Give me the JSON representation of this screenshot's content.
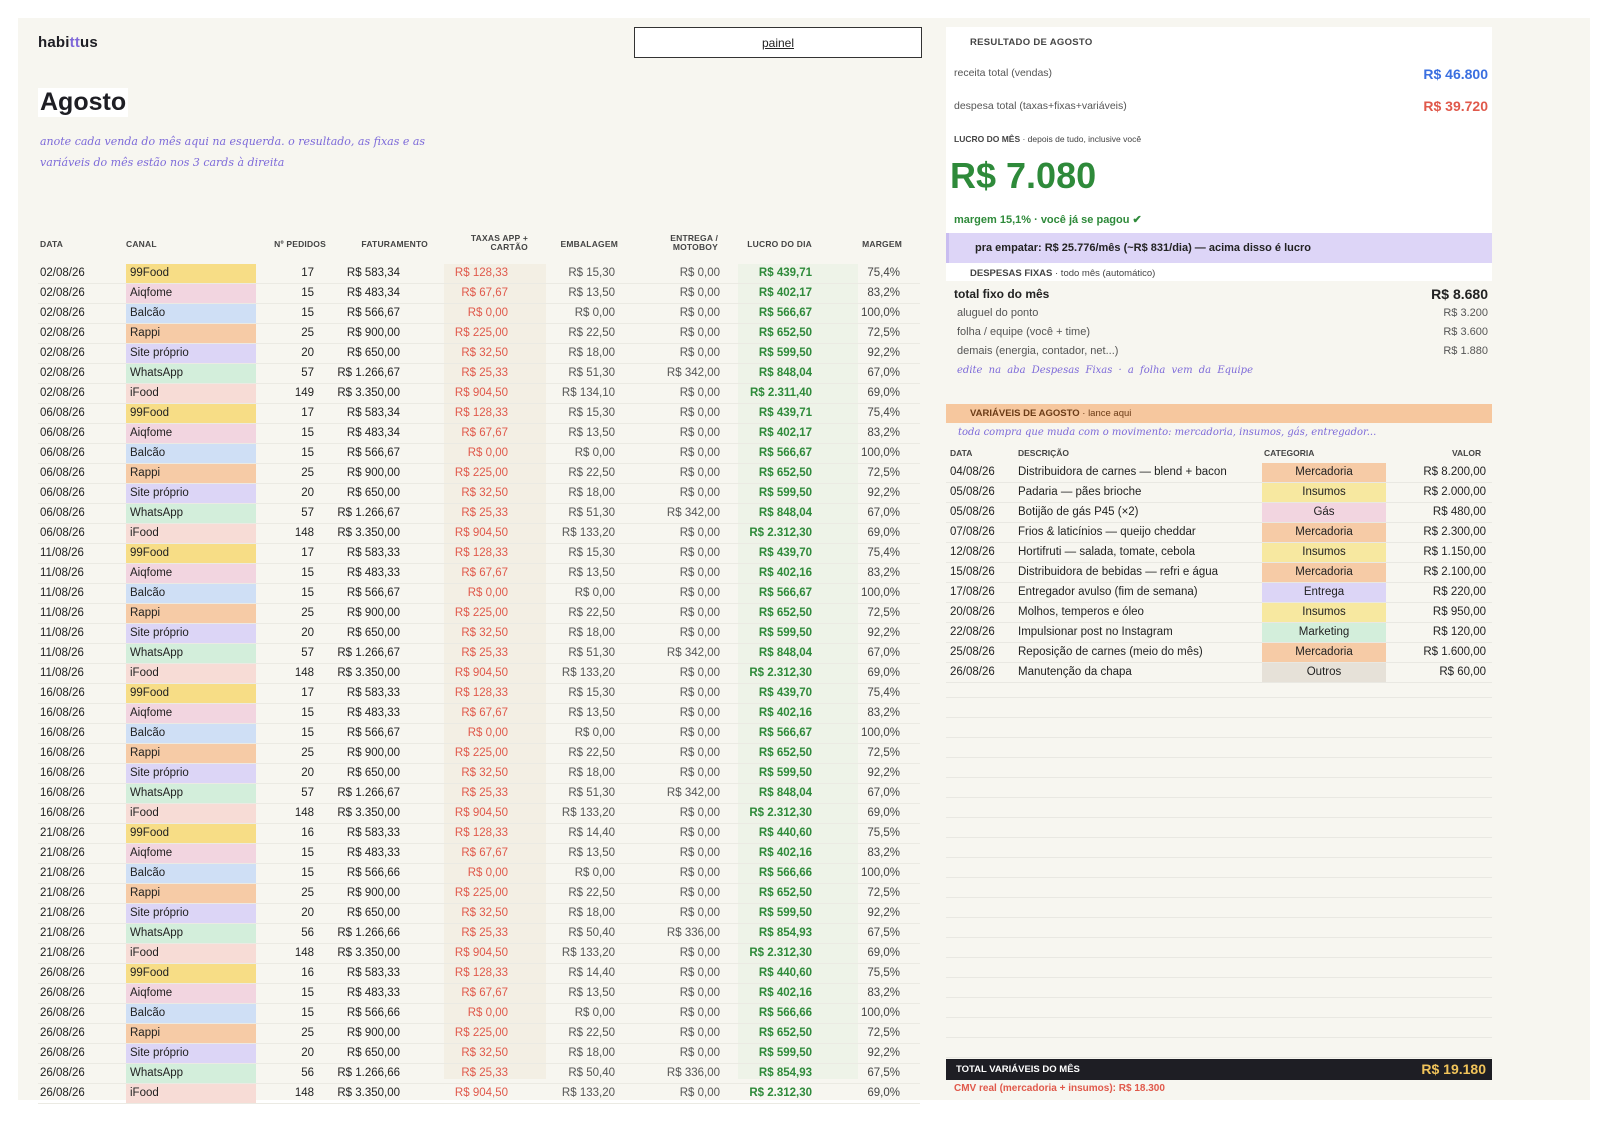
{
  "brand": {
    "pre": "habi",
    "mid": "tt",
    "post": "us"
  },
  "nav": {
    "painel": "painel"
  },
  "title": "Agosto",
  "subtitle": "anote cada venda do mês aqui na esquerda. o resultado, as fixas e as variáveis do mês estão nos 3 cards à direita",
  "sales": {
    "headers": {
      "data": "DATA",
      "canal": "CANAL",
      "pedidos": "Nº PEDIDOS",
      "faturamento": "FATURAMENTO",
      "taxas": "TAXAS APP + CARTÃO",
      "embalagem": "EMBALAGEM",
      "entrega": "ENTREGA / MOTOBOY",
      "lucro": "LUCRO DO DIA",
      "margem": "MARGEM"
    },
    "rows": [
      [
        "02/08/26",
        "99Food",
        "17",
        "R$ 583,34",
        "R$ 128,33",
        "R$ 15,30",
        "R$ 0,00",
        "R$ 439,71",
        "75,4%"
      ],
      [
        "02/08/26",
        "Aiqfome",
        "15",
        "R$ 483,34",
        "R$ 67,67",
        "R$ 13,50",
        "R$ 0,00",
        "R$ 402,17",
        "83,2%"
      ],
      [
        "02/08/26",
        "Balcão",
        "15",
        "R$ 566,67",
        "R$ 0,00",
        "R$ 0,00",
        "R$ 0,00",
        "R$ 566,67",
        "100,0%"
      ],
      [
        "02/08/26",
        "Rappi",
        "25",
        "R$ 900,00",
        "R$ 225,00",
        "R$ 22,50",
        "R$ 0,00",
        "R$ 652,50",
        "72,5%"
      ],
      [
        "02/08/26",
        "Site próprio",
        "20",
        "R$ 650,00",
        "R$ 32,50",
        "R$ 18,00",
        "R$ 0,00",
        "R$ 599,50",
        "92,2%"
      ],
      [
        "02/08/26",
        "WhatsApp",
        "57",
        "R$ 1.266,67",
        "R$ 25,33",
        "R$ 51,30",
        "R$ 342,00",
        "R$ 848,04",
        "67,0%"
      ],
      [
        "02/08/26",
        "iFood",
        "149",
        "R$ 3.350,00",
        "R$ 904,50",
        "R$ 134,10",
        "R$ 0,00",
        "R$ 2.311,40",
        "69,0%"
      ],
      [
        "06/08/26",
        "99Food",
        "17",
        "R$ 583,34",
        "R$ 128,33",
        "R$ 15,30",
        "R$ 0,00",
        "R$ 439,71",
        "75,4%"
      ],
      [
        "06/08/26",
        "Aiqfome",
        "15",
        "R$ 483,34",
        "R$ 67,67",
        "R$ 13,50",
        "R$ 0,00",
        "R$ 402,17",
        "83,2%"
      ],
      [
        "06/08/26",
        "Balcão",
        "15",
        "R$ 566,67",
        "R$ 0,00",
        "R$ 0,00",
        "R$ 0,00",
        "R$ 566,67",
        "100,0%"
      ],
      [
        "06/08/26",
        "Rappi",
        "25",
        "R$ 900,00",
        "R$ 225,00",
        "R$ 22,50",
        "R$ 0,00",
        "R$ 652,50",
        "72,5%"
      ],
      [
        "06/08/26",
        "Site próprio",
        "20",
        "R$ 650,00",
        "R$ 32,50",
        "R$ 18,00",
        "R$ 0,00",
        "R$ 599,50",
        "92,2%"
      ],
      [
        "06/08/26",
        "WhatsApp",
        "57",
        "R$ 1.266,67",
        "R$ 25,33",
        "R$ 51,30",
        "R$ 342,00",
        "R$ 848,04",
        "67,0%"
      ],
      [
        "06/08/26",
        "iFood",
        "148",
        "R$ 3.350,00",
        "R$ 904,50",
        "R$ 133,20",
        "R$ 0,00",
        "R$ 2.312,30",
        "69,0%"
      ],
      [
        "11/08/26",
        "99Food",
        "17",
        "R$ 583,33",
        "R$ 128,33",
        "R$ 15,30",
        "R$ 0,00",
        "R$ 439,70",
        "75,4%"
      ],
      [
        "11/08/26",
        "Aiqfome",
        "15",
        "R$ 483,33",
        "R$ 67,67",
        "R$ 13,50",
        "R$ 0,00",
        "R$ 402,16",
        "83,2%"
      ],
      [
        "11/08/26",
        "Balcão",
        "15",
        "R$ 566,67",
        "R$ 0,00",
        "R$ 0,00",
        "R$ 0,00",
        "R$ 566,67",
        "100,0%"
      ],
      [
        "11/08/26",
        "Rappi",
        "25",
        "R$ 900,00",
        "R$ 225,00",
        "R$ 22,50",
        "R$ 0,00",
        "R$ 652,50",
        "72,5%"
      ],
      [
        "11/08/26",
        "Site próprio",
        "20",
        "R$ 650,00",
        "R$ 32,50",
        "R$ 18,00",
        "R$ 0,00",
        "R$ 599,50",
        "92,2%"
      ],
      [
        "11/08/26",
        "WhatsApp",
        "57",
        "R$ 1.266,67",
        "R$ 25,33",
        "R$ 51,30",
        "R$ 342,00",
        "R$ 848,04",
        "67,0%"
      ],
      [
        "11/08/26",
        "iFood",
        "148",
        "R$ 3.350,00",
        "R$ 904,50",
        "R$ 133,20",
        "R$ 0,00",
        "R$ 2.312,30",
        "69,0%"
      ],
      [
        "16/08/26",
        "99Food",
        "17",
        "R$ 583,33",
        "R$ 128,33",
        "R$ 15,30",
        "R$ 0,00",
        "R$ 439,70",
        "75,4%"
      ],
      [
        "16/08/26",
        "Aiqfome",
        "15",
        "R$ 483,33",
        "R$ 67,67",
        "R$ 13,50",
        "R$ 0,00",
        "R$ 402,16",
        "83,2%"
      ],
      [
        "16/08/26",
        "Balcão",
        "15",
        "R$ 566,67",
        "R$ 0,00",
        "R$ 0,00",
        "R$ 0,00",
        "R$ 566,67",
        "100,0%"
      ],
      [
        "16/08/26",
        "Rappi",
        "25",
        "R$ 900,00",
        "R$ 225,00",
        "R$ 22,50",
        "R$ 0,00",
        "R$ 652,50",
        "72,5%"
      ],
      [
        "16/08/26",
        "Site próprio",
        "20",
        "R$ 650,00",
        "R$ 32,50",
        "R$ 18,00",
        "R$ 0,00",
        "R$ 599,50",
        "92,2%"
      ],
      [
        "16/08/26",
        "WhatsApp",
        "57",
        "R$ 1.266,67",
        "R$ 25,33",
        "R$ 51,30",
        "R$ 342,00",
        "R$ 848,04",
        "67,0%"
      ],
      [
        "16/08/26",
        "iFood",
        "148",
        "R$ 3.350,00",
        "R$ 904,50",
        "R$ 133,20",
        "R$ 0,00",
        "R$ 2.312,30",
        "69,0%"
      ],
      [
        "21/08/26",
        "99Food",
        "16",
        "R$ 583,33",
        "R$ 128,33",
        "R$ 14,40",
        "R$ 0,00",
        "R$ 440,60",
        "75,5%"
      ],
      [
        "21/08/26",
        "Aiqfome",
        "15",
        "R$ 483,33",
        "R$ 67,67",
        "R$ 13,50",
        "R$ 0,00",
        "R$ 402,16",
        "83,2%"
      ],
      [
        "21/08/26",
        "Balcão",
        "15",
        "R$ 566,66",
        "R$ 0,00",
        "R$ 0,00",
        "R$ 0,00",
        "R$ 566,66",
        "100,0%"
      ],
      [
        "21/08/26",
        "Rappi",
        "25",
        "R$ 900,00",
        "R$ 225,00",
        "R$ 22,50",
        "R$ 0,00",
        "R$ 652,50",
        "72,5%"
      ],
      [
        "21/08/26",
        "Site próprio",
        "20",
        "R$ 650,00",
        "R$ 32,50",
        "R$ 18,00",
        "R$ 0,00",
        "R$ 599,50",
        "92,2%"
      ],
      [
        "21/08/26",
        "WhatsApp",
        "56",
        "R$ 1.266,66",
        "R$ 25,33",
        "R$ 50,40",
        "R$ 336,00",
        "R$ 854,93",
        "67,5%"
      ],
      [
        "21/08/26",
        "iFood",
        "148",
        "R$ 3.350,00",
        "R$ 904,50",
        "R$ 133,20",
        "R$ 0,00",
        "R$ 2.312,30",
        "69,0%"
      ],
      [
        "26/08/26",
        "99Food",
        "16",
        "R$ 583,33",
        "R$ 128,33",
        "R$ 14,40",
        "R$ 0,00",
        "R$ 440,60",
        "75,5%"
      ],
      [
        "26/08/26",
        "Aiqfome",
        "15",
        "R$ 483,33",
        "R$ 67,67",
        "R$ 13,50",
        "R$ 0,00",
        "R$ 402,16",
        "83,2%"
      ],
      [
        "26/08/26",
        "Balcão",
        "15",
        "R$ 566,66",
        "R$ 0,00",
        "R$ 0,00",
        "R$ 0,00",
        "R$ 566,66",
        "100,0%"
      ],
      [
        "26/08/26",
        "Rappi",
        "25",
        "R$ 900,00",
        "R$ 225,00",
        "R$ 22,50",
        "R$ 0,00",
        "R$ 652,50",
        "72,5%"
      ],
      [
        "26/08/26",
        "Site próprio",
        "20",
        "R$ 650,00",
        "R$ 32,50",
        "R$ 18,00",
        "R$ 0,00",
        "R$ 599,50",
        "92,2%"
      ],
      [
        "26/08/26",
        "WhatsApp",
        "56",
        "R$ 1.266,66",
        "R$ 25,33",
        "R$ 50,40",
        "R$ 336,00",
        "R$ 854,93",
        "67,5%"
      ],
      [
        "26/08/26",
        "iFood",
        "148",
        "R$ 3.350,00",
        "R$ 904,50",
        "R$ 133,20",
        "R$ 0,00",
        "R$ 2.312,30",
        "69,0%"
      ]
    ]
  },
  "channel_colors": {
    "99Food": "#f7dd86",
    "Aiqfome": "#f2d5e0",
    "Balcão": "#cfdff5",
    "Rappi": "#f6cba6",
    "Site próprio": "#dcd5f6",
    "WhatsApp": "#d3eedb",
    "iFood": "#f7dcd6"
  },
  "resultado": {
    "title": "RESULTADO DE AGOSTO",
    "receita_label": "receita total (vendas)",
    "receita_value": "R$ 46.800",
    "despesa_label": "despesa total (taxas+fixas+variáveis)",
    "despesa_value": "R$ 39.720",
    "lucro_label": "LUCRO DO MÊS",
    "lucro_sub": " · depois de tudo, inclusive você",
    "lucro_value": "R$ 7.080",
    "margem_note": "margem 15,1% · você já se pagou ✔",
    "empatar": "pra empatar: R$ 25.776/mês  (~R$ 831/dia) — acima disso é lucro"
  },
  "fixas": {
    "title": "DESPESAS FIXAS",
    "title_sub": " · todo mês (automático)",
    "total_label": "total fixo do mês",
    "total_value": "R$ 8.680",
    "items": [
      {
        "label": "aluguel do ponto",
        "value": "R$ 3.200"
      },
      {
        "label": "folha / equipe (você + time)",
        "value": "R$ 3.600"
      },
      {
        "label": "demais (energia, contador, net...)",
        "value": "R$ 1.880"
      }
    ],
    "edit_note": "edite na aba   Despesas Fixas · a folha vem da   Equipe"
  },
  "variaveis": {
    "title": "VARIÁVEIS DE AGOSTO",
    "title_sub": " · lance aqui",
    "note": "toda compra que muda com o movimento: mercadoria, insumos, gás, entregador...",
    "headers": {
      "data": "DATA",
      "descricao": "DESCRIÇÃO",
      "categoria": "CATEGORIA",
      "valor": "VALOR"
    },
    "rows": [
      [
        "04/08/26",
        "Distribuidora de carnes — blend + bacon",
        "Mercadoria",
        "R$ 8.200,00"
      ],
      [
        "05/08/26",
        "Padaria — pães brioche",
        "Insumos",
        "R$ 2.000,00"
      ],
      [
        "05/08/26",
        "Botijão de gás P45 (×2)",
        "Gás",
        "R$ 480,00"
      ],
      [
        "07/08/26",
        "Frios & laticínios — queijo cheddar",
        "Mercadoria",
        "R$ 2.300,00"
      ],
      [
        "12/08/26",
        "Hortifruti — salada, tomate, cebola",
        "Insumos",
        "R$ 1.150,00"
      ],
      [
        "15/08/26",
        "Distribuidora de bebidas — refri e água",
        "Mercadoria",
        "R$ 2.100,00"
      ],
      [
        "17/08/26",
        "Entregador avulso (fim de semana)",
        "Entrega",
        "R$ 220,00"
      ],
      [
        "20/08/26",
        "Molhos, temperos e óleo",
        "Insumos",
        "R$ 950,00"
      ],
      [
        "22/08/26",
        "Impulsionar post no Instagram",
        "Marketing",
        "R$ 120,00"
      ],
      [
        "25/08/26",
        "Reposição de carnes (meio do mês)",
        "Mercadoria",
        "R$ 1.600,00"
      ],
      [
        "26/08/26",
        "Manutenção da chapa",
        "Outros",
        "R$ 60,00"
      ]
    ],
    "category_colors": {
      "Mercadoria": "#f6cba6",
      "Insumos": "#f7e8a0",
      "Gás": "#f2d5e0",
      "Entrega": "#dcd5f6",
      "Marketing": "#d3eedb",
      "Outros": "#e6e1d8"
    },
    "total_label": "TOTAL VARIÁVEIS DO MÊS",
    "total_value": "R$ 19.180",
    "cmv": "CMV real (mercadoria + insumos): R$ 18.300"
  },
  "colors": {
    "accent_purple": "#7d6ad9",
    "profit_green": "#2e8a3a",
    "expense_red": "#e0594b",
    "revenue_blue": "#3a6fe0"
  }
}
